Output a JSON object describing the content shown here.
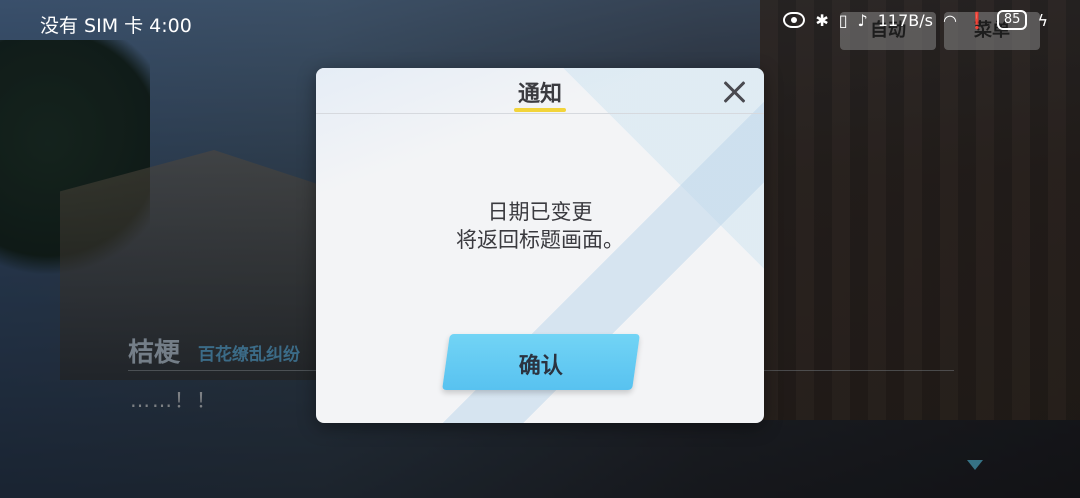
{
  "status_bar": {
    "carrier_time": "没有 SIM 卡 4:00",
    "net_speed": "117B/s",
    "battery": "85",
    "icons": [
      "eye-icon",
      "bluetooth-icon",
      "vibrate-icon",
      "mute-bell-icon",
      "wifi-icon",
      "alert-icon",
      "charging-icon"
    ]
  },
  "game_buttons": {
    "auto": "自动",
    "menu": "菜单"
  },
  "dialogue": {
    "speaker": "桔梗",
    "speaker_sub": "百花缭乱纠纷",
    "text": "……！！"
  },
  "modal": {
    "title": "通知",
    "message_line1": "日期已变更",
    "message_line2": "将返回标题画面。",
    "confirm_label": "确认"
  },
  "colors": {
    "accent_yellow": "#f2d43a",
    "confirm_blue": "#5ec4f0",
    "speaker_sub_blue": "#66b8e8"
  }
}
